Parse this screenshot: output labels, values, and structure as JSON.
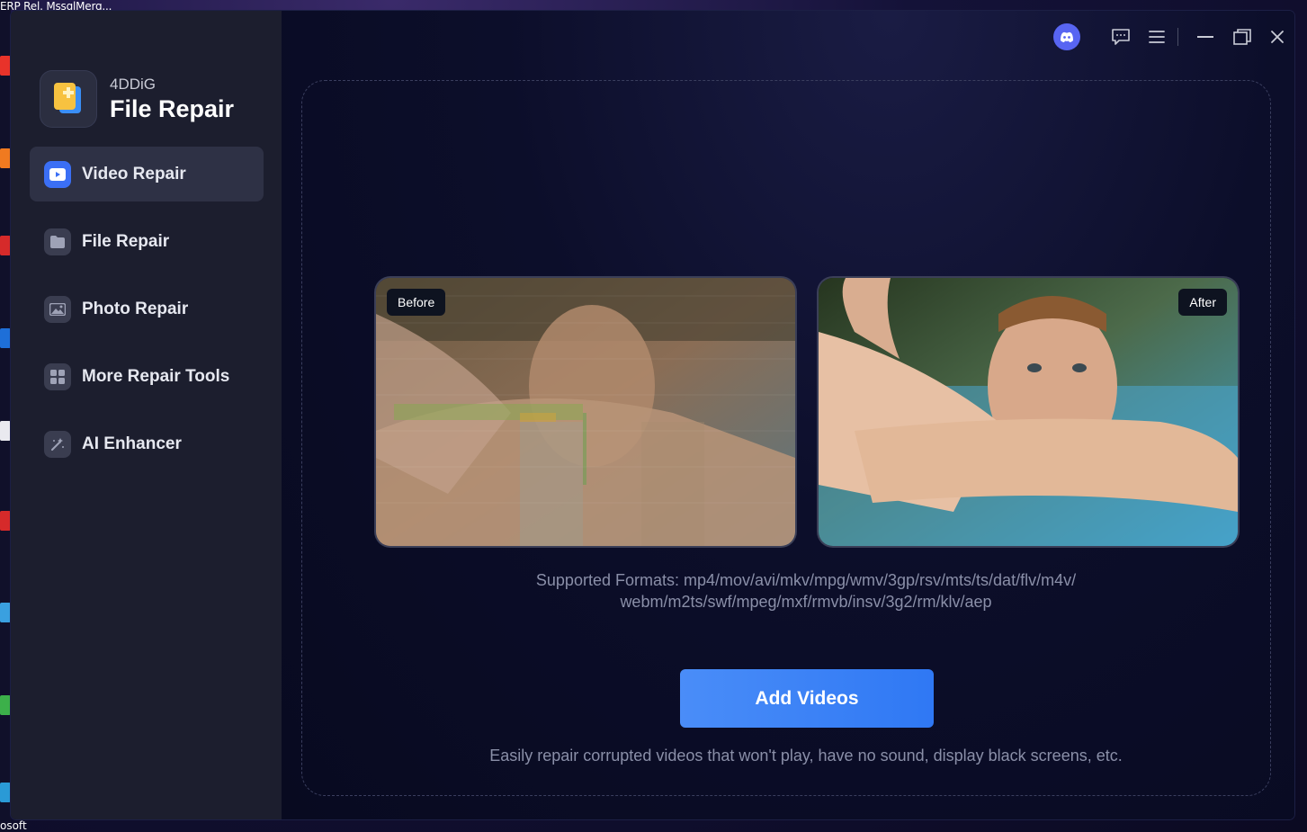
{
  "desktop": {
    "top_text": "ERP Rel. MssqlMerg...",
    "bottom_text": "osoft"
  },
  "app": {
    "brand": "4DDiG",
    "product": "File Repair"
  },
  "sidebar": {
    "items": [
      {
        "label": "Video Repair",
        "icon": "video-icon",
        "active": true
      },
      {
        "label": "File Repair",
        "icon": "folder-icon",
        "active": false
      },
      {
        "label": "Photo Repair",
        "icon": "photo-icon",
        "active": false
      },
      {
        "label": "More Repair Tools",
        "icon": "grid-icon",
        "active": false
      },
      {
        "label": "AI Enhancer",
        "icon": "magic-wand-icon",
        "active": false
      }
    ]
  },
  "titlebar": {
    "icons": [
      "discord-icon",
      "feedback-icon",
      "menu-icon",
      "minimize-icon",
      "restore-icon",
      "close-icon"
    ]
  },
  "main": {
    "before_label": "Before",
    "after_label": "After",
    "formats_line1": "Supported Formats: mp4/mov/avi/mkv/mpg/wmv/3gp/rsv/mts/ts/dat/flv/m4v/",
    "formats_line2": "webm/m2ts/swf/mpeg/mxf/rmvb/insv/3g2/rm/klv/aep",
    "add_button": "Add Videos",
    "hint": "Easily repair corrupted videos that won't play, have no sound, display black screens, etc."
  },
  "colors": {
    "accent": "#2f78f4",
    "sidebar_bg": "#1c1e2e",
    "main_bg": "#0a0c24"
  }
}
